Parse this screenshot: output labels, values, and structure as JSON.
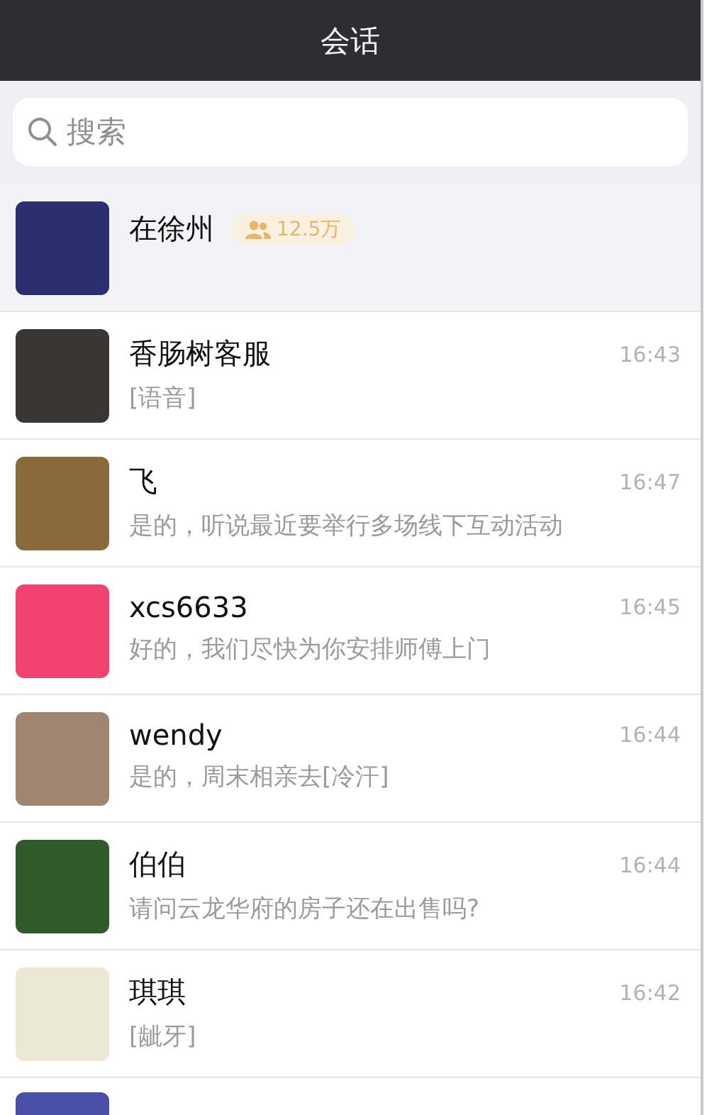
{
  "header": {
    "title": "会话"
  },
  "search": {
    "placeholder": "搜索"
  },
  "chats": [
    {
      "kind": "group",
      "pinned": true,
      "name": "在徐州",
      "members": "12.5万"
    },
    {
      "kind": "contact",
      "pinned": false,
      "name": "香肠树客服",
      "preview": "[语音]",
      "time": "16:43"
    },
    {
      "kind": "contact",
      "pinned": false,
      "name": "飞",
      "preview": "是的，听说最近要举行多场线下互动活动",
      "time": "16:47"
    },
    {
      "kind": "contact",
      "pinned": false,
      "name": "xcs6633",
      "preview": "好的，我们尽快为你安排师傅上门",
      "time": "16:45"
    },
    {
      "kind": "contact",
      "pinned": false,
      "name": "wendy",
      "preview": "是的，周末相亲去[冷汗]",
      "time": "16:44"
    },
    {
      "kind": "contact",
      "pinned": false,
      "name": "伯伯",
      "preview": "请问云龙华府的房子还在出售吗?",
      "time": "16:44"
    },
    {
      "kind": "contact",
      "pinned": false,
      "name": "琪琪",
      "preview": "[龇牙]",
      "time": "16:42"
    }
  ]
}
